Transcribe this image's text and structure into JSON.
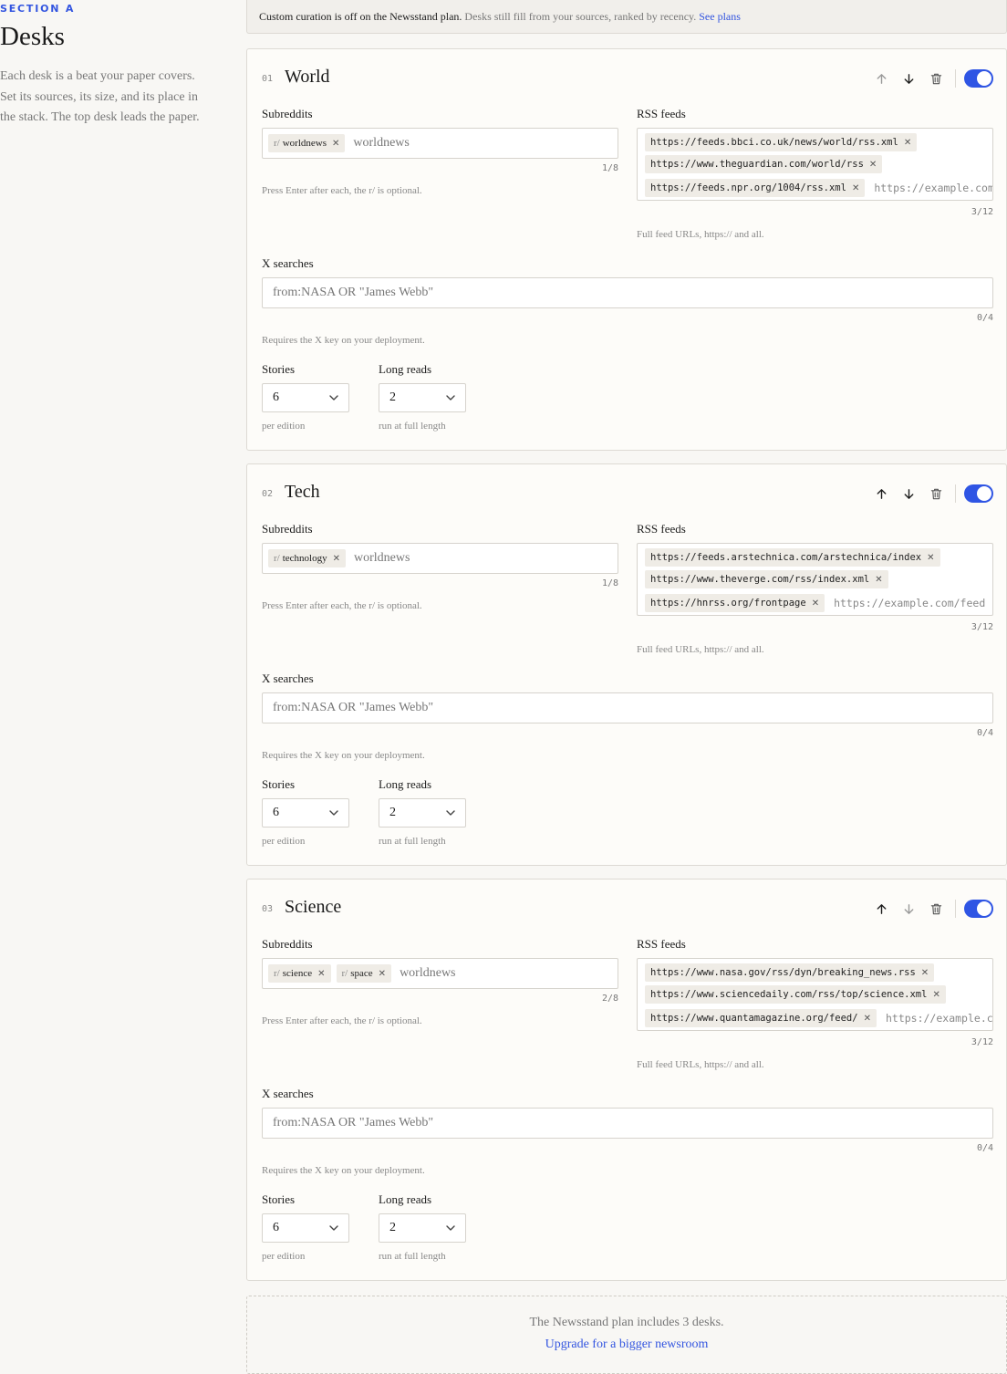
{
  "section": {
    "eyebrow": "SECTION A",
    "title": "Desks",
    "description": "Each desk is a beat your paper covers. Set its sources, its size, and its place in the stack. The top desk leads the paper."
  },
  "notice": {
    "strong": "Custom curation is off on the Newsstand plan.",
    "rest": " Desks still fill from your sources, ranked by recency.",
    "link": "See plans"
  },
  "labels": {
    "subreddits": "Subreddits",
    "rss": "RSS feeds",
    "x_searches": "X searches",
    "stories": "Stories",
    "long_reads": "Long reads",
    "sub_hint": "Press Enter after each, the r/ is optional.",
    "rss_hint": "Full feed URLs, https:// and all.",
    "x_hint": "Requires the X key on your deployment.",
    "stories_hint": "per edition",
    "long_hint": "run at full length",
    "r_prefix": "r/",
    "remove_glyph": "✕"
  },
  "desks": [
    {
      "number": "01",
      "name": "World",
      "enabled": true,
      "subreddits": [
        "worldnews"
      ],
      "subreddit_input": "worldnews",
      "subreddit_count": "1/8",
      "rss": [
        "https://feeds.bbci.co.uk/news/world/rss.xml",
        "https://www.theguardian.com/world/rss",
        "https://feeds.npr.org/1004/rss.xml"
      ],
      "rss_placeholder": "https://example.com/feed",
      "rss_count": "3/12",
      "x_placeholder": "from:NASA OR \"James Webb\"",
      "x_count": "0/4",
      "stories": "6",
      "long_reads": "2",
      "up_enabled": false,
      "down_enabled": true
    },
    {
      "number": "02",
      "name": "Tech",
      "enabled": true,
      "subreddits": [
        "technology"
      ],
      "subreddit_input": "worldnews",
      "subreddit_count": "1/8",
      "rss": [
        "https://feeds.arstechnica.com/arstechnica/index",
        "https://www.theverge.com/rss/index.xml",
        "https://hnrss.org/frontpage"
      ],
      "rss_placeholder": "https://example.com/feed",
      "rss_count": "3/12",
      "x_placeholder": "from:NASA OR \"James Webb\"",
      "x_count": "0/4",
      "stories": "6",
      "long_reads": "2",
      "up_enabled": true,
      "down_enabled": true
    },
    {
      "number": "03",
      "name": "Science",
      "enabled": true,
      "subreddits": [
        "science",
        "space"
      ],
      "subreddit_input": "worldnews",
      "subreddit_count": "2/8",
      "rss": [
        "https://www.nasa.gov/rss/dyn/breaking_news.rss",
        "https://www.sciencedaily.com/rss/top/science.xml",
        "https://www.quantamagazine.org/feed/"
      ],
      "rss_placeholder": "https://example.com/feed",
      "rss_count": "3/12",
      "x_placeholder": "from:NASA OR \"James Webb\"",
      "x_count": "0/4",
      "stories": "6",
      "long_reads": "2",
      "up_enabled": true,
      "down_enabled": false
    }
  ],
  "promo": {
    "text": "The Newsstand plan includes 3 desks.",
    "link": "Upgrade for a bigger newsroom"
  },
  "colors": {
    "accent": "#2f55e4",
    "link": "#3355e0",
    "page_bg": "#f8f7f4",
    "card_bg": "#fdfcf9"
  }
}
